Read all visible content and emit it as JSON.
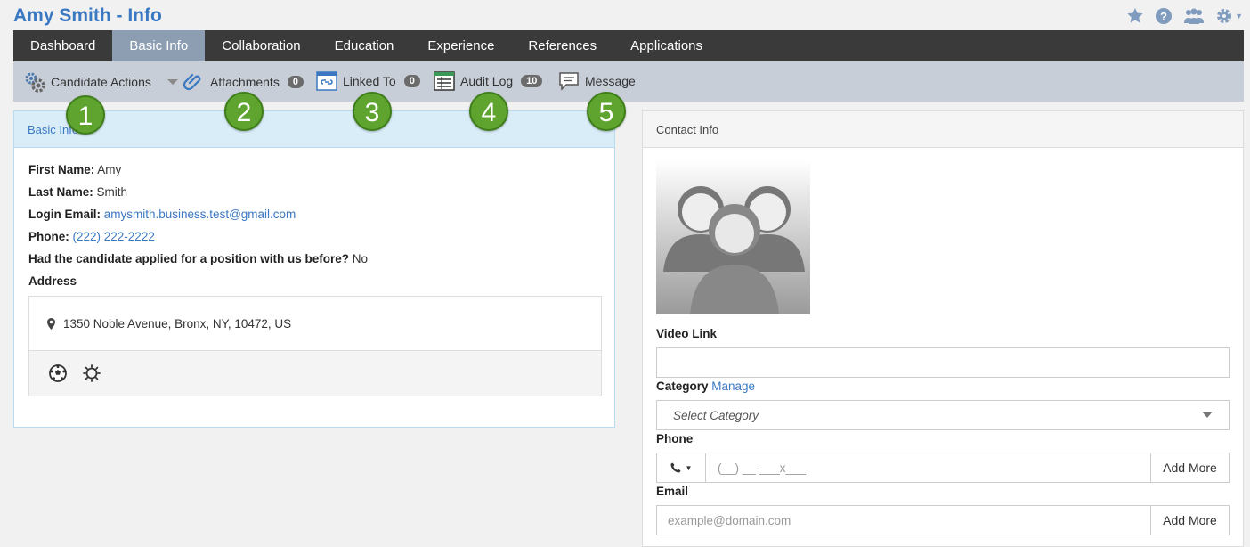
{
  "title": "Amy Smith - Info",
  "nav": {
    "tabs": [
      {
        "label": "Dashboard"
      },
      {
        "label": "Basic Info"
      },
      {
        "label": "Collaboration"
      },
      {
        "label": "Education"
      },
      {
        "label": "Experience"
      },
      {
        "label": "References"
      },
      {
        "label": "Applications"
      }
    ],
    "active": "Basic Info"
  },
  "actions": {
    "candidate_actions": "Candidate Actions",
    "attachments": {
      "label": "Attachments",
      "count": "0"
    },
    "linked_to": {
      "label": "Linked To",
      "count": "0"
    },
    "audit_log": {
      "label": "Audit Log",
      "count": "10"
    },
    "message": "Message"
  },
  "callouts": [
    "1",
    "2",
    "3",
    "4",
    "5"
  ],
  "basic_info": {
    "heading": "Basic Info",
    "first_name_label": "First Name:",
    "first_name": "Amy",
    "last_name_label": "Last Name:",
    "last_name": "Smith",
    "login_email_label": "Login Email:",
    "login_email": "amysmith.business.test@gmail.com",
    "phone_label": "Phone:",
    "phone": "(222) 222-2222",
    "applied_before_label": "Had the candidate applied for a position with us before?",
    "applied_before": "No",
    "address_label": "Address",
    "address": "1350 Noble Avenue, Bronx, NY, 10472, US"
  },
  "contact_info": {
    "heading": "Contact Info",
    "video_link_label": "Video Link",
    "video_link_value": "",
    "category_label": "Category",
    "category_manage": "Manage",
    "category_placeholder": "Select Category",
    "phone_label": "Phone",
    "phone_placeholder": "(__) __-___x___",
    "phone_add_more": "Add More",
    "email_label": "Email",
    "email_placeholder": "example@domain.com",
    "email_add_more": "Add More"
  },
  "colors": {
    "accent": "#3a78c2",
    "nav_bg": "#3a3a3a",
    "callout_green": "#5ea42f"
  }
}
